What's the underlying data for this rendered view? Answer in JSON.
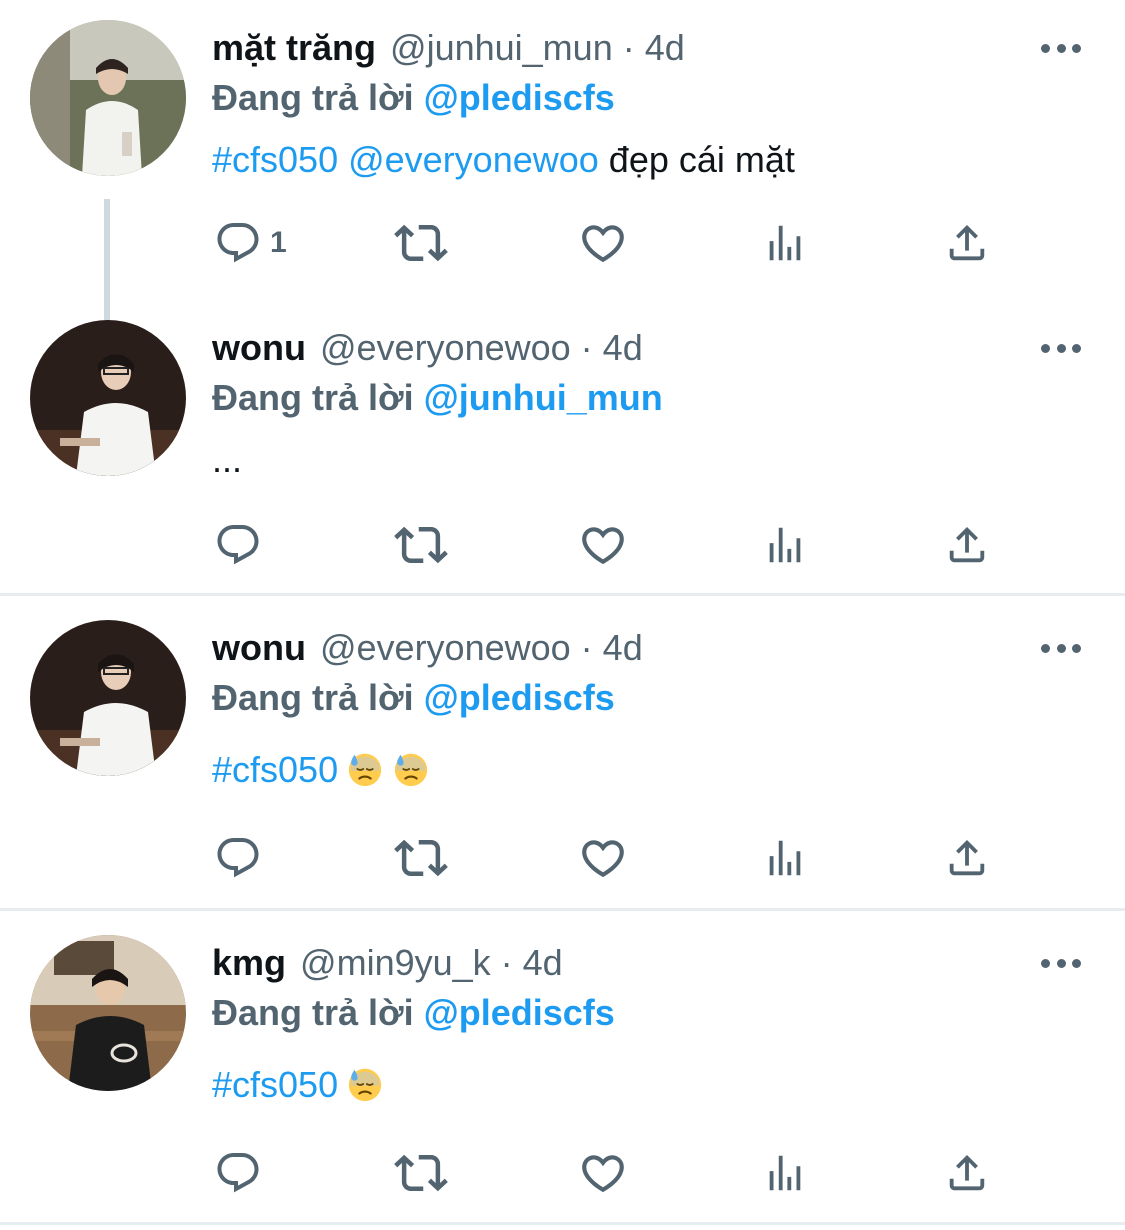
{
  "tweets": [
    {
      "name": "mặt trăng",
      "handle": "@junhui_mun",
      "separator": "·",
      "time": "4d",
      "reply_prefix": "Đang trả lời",
      "reply_to": "@plediscfs",
      "text_hashtag": "#cfs050",
      "text_mention": "@everyonewoo",
      "text_rest": " đẹp cái mặt",
      "reply_count": "1"
    },
    {
      "name": "wonu",
      "handle": "@everyonewoo",
      "separator": "·",
      "time": "4d",
      "reply_prefix": "Đang trả lời",
      "reply_to": "@junhui_mun",
      "text": "...",
      "reply_count": ""
    },
    {
      "name": "wonu",
      "handle": "@everyonewoo",
      "separator": "·",
      "time": "4d",
      "reply_prefix": "Đang trả lời",
      "reply_to": "@plediscfs",
      "text_hashtag": "#cfs050",
      "emojis": [
        "downcast-face-with-sweat",
        "downcast-face-with-sweat"
      ],
      "reply_count": ""
    },
    {
      "name": "kmg",
      "handle": "@min9yu_k",
      "separator": "·",
      "time": "4d",
      "reply_prefix": "Đang trả lời",
      "reply_to": "@plediscfs",
      "text_hashtag": "#cfs050",
      "emojis": [
        "downcast-face-with-sweat"
      ],
      "reply_count": ""
    }
  ],
  "icons": {
    "reply": "reply-icon",
    "retweet": "retweet-icon",
    "like": "heart-icon",
    "views": "views-icon",
    "share": "share-icon",
    "more": "more-icon"
  },
  "colors": {
    "link": "#1d9bf0",
    "muted": "#536471",
    "text": "#0f1419",
    "divider": "#e6ecf0",
    "thread_line": "#cfd9de"
  }
}
